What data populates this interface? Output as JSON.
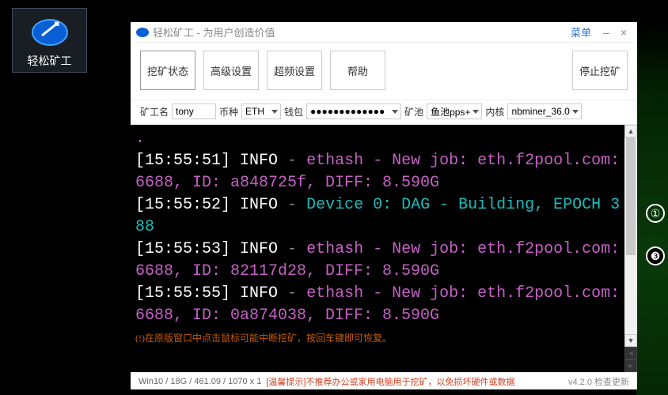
{
  "desktop": {
    "label": "轻松矿工"
  },
  "titlebar": {
    "title": "轻松矿工 - 为用户创造价值",
    "menu": "菜单"
  },
  "tabs": {
    "status": "挖矿状态",
    "advanced": "高级设置",
    "overclock": "超频设置",
    "help": "帮助",
    "stop": "停止挖矿"
  },
  "config": {
    "miner_label": "矿工名",
    "miner_value": "tony",
    "coin_label": "币种",
    "coin_value": "ETH",
    "wallet_label": "钱包",
    "wallet_value": "●●●●●●●●●●●●●",
    "pool_label": "矿池",
    "pool_value": "鱼池pps+",
    "core_label": "内核",
    "core_value": "nbminer_36.0"
  },
  "console": {
    "line1_ts": "[15:55:51]",
    "line1_info": " INFO ",
    "line1_dash": "- ",
    "line1_key": "ethash",
    "line1_mid": " - New job: ",
    "line1_rest": "eth.f2pool.com:6688, ID: a848725f, DIFF: 8.590G",
    "line2_ts": "[15:55:52]",
    "line2_info": " INFO ",
    "line2_dash": "- ",
    "line2_key": "Device 0: DAG",
    "line2_rest": " - Building, EPOCH 388",
    "line3_ts": "[15:55:53]",
    "line3_info": " INFO ",
    "line3_dash": "- ",
    "line3_key": "ethash",
    "line3_mid": " - New job: ",
    "line3_rest": "eth.f2pool.com:6688, ID: 82117d28, DIFF: 8.590G",
    "line4_ts": "[15:55:55]",
    "line4_info": " INFO ",
    "line4_dash": "- ",
    "line4_key": "ethash",
    "line4_mid": " - New job: ",
    "line4_rest": "eth.f2pool.com:6688, ID: 0a874038, DIFF: 8.590G",
    "footer_warn": "(!)在原版窗口中点击鼠标可能中断挖矿，按回车键即可恢复。"
  },
  "status": {
    "sys": "Win10  /  18G / 461.09  /  1070 x 1",
    "tip": "[温馨提示]不推荐办公或家用电脑用于挖矿，以免损坏硬件或数据",
    "ver": "v4.2.0 检查更新"
  }
}
